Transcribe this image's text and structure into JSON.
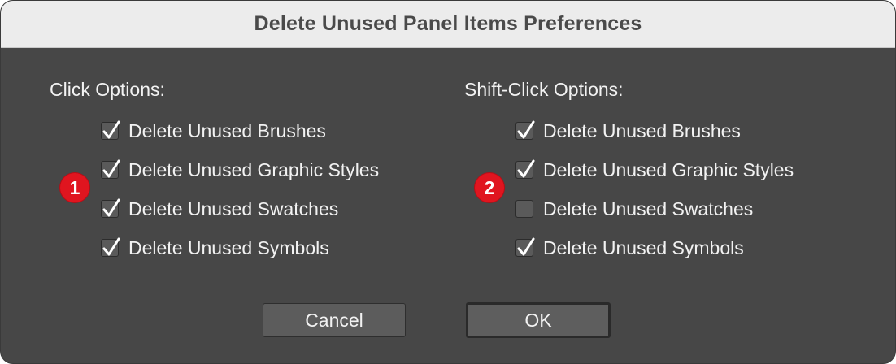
{
  "dialog": {
    "title": "Delete Unused Panel Items Preferences"
  },
  "click_options": {
    "label": "Click Options:",
    "badge": "1",
    "items": [
      {
        "label": "Delete Unused Brushes",
        "checked": true
      },
      {
        "label": "Delete Unused Graphic Styles",
        "checked": true
      },
      {
        "label": "Delete Unused Swatches",
        "checked": true
      },
      {
        "label": "Delete Unused Symbols",
        "checked": true
      }
    ]
  },
  "shift_click_options": {
    "label": "Shift-Click Options:",
    "badge": "2",
    "items": [
      {
        "label": "Delete Unused Brushes",
        "checked": true
      },
      {
        "label": "Delete Unused Graphic Styles",
        "checked": true
      },
      {
        "label": "Delete Unused Swatches",
        "checked": false
      },
      {
        "label": "Delete Unused Symbols",
        "checked": true
      }
    ]
  },
  "buttons": {
    "cancel": "Cancel",
    "ok": "OK"
  },
  "colors": {
    "badge": "#e0151f",
    "dialog_bg": "#474747",
    "titlebar_bg": "#ececec"
  }
}
